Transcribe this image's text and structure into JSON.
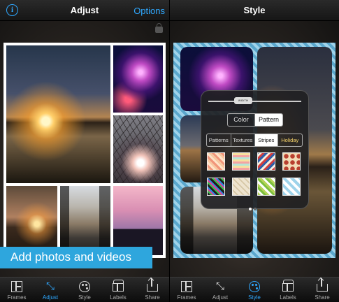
{
  "left_screen": {
    "title": "Adjust",
    "info_label": "i",
    "options_label": "Options",
    "banner": "Add photos and videos",
    "tabs": [
      {
        "label": "Frames",
        "icon": "frames-icon"
      },
      {
        "label": "Adjust",
        "icon": "adjust-icon",
        "active": true
      },
      {
        "label": "Style",
        "icon": "style-icon"
      },
      {
        "label": "Labels",
        "icon": "labels-icon"
      },
      {
        "label": "Share",
        "icon": "share-icon"
      }
    ]
  },
  "right_screen": {
    "title": "Style",
    "popover": {
      "slider_label": "WIDTH",
      "type_options": [
        "Color",
        "Pattern"
      ],
      "type_selected": "Pattern",
      "categories": [
        "Patterns",
        "Textures",
        "Stripes",
        "Holiday"
      ],
      "category_selected": "Stripes",
      "page_count": 2,
      "page_active": 0
    },
    "tabs": [
      {
        "label": "Frames",
        "icon": "frames-icon"
      },
      {
        "label": "Adjust",
        "icon": "adjust-icon"
      },
      {
        "label": "Style",
        "icon": "style-icon",
        "active": true
      },
      {
        "label": "Labels",
        "icon": "labels-icon"
      },
      {
        "label": "Share",
        "icon": "share-icon"
      }
    ]
  },
  "colors": {
    "accent": "#2fa8ff",
    "banner": "#2ea6dd"
  }
}
